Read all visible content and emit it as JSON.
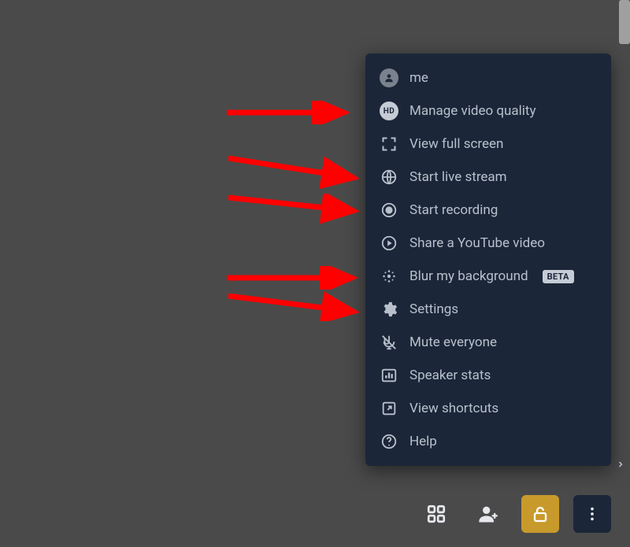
{
  "menu": {
    "items": [
      {
        "icon": "avatar-icon",
        "label": "me"
      },
      {
        "icon": "hd-icon",
        "hd_text": "HD",
        "label": "Manage video quality"
      },
      {
        "icon": "fullscreen-icon",
        "label": "View full screen"
      },
      {
        "icon": "globe-icon",
        "label": "Start live stream"
      },
      {
        "icon": "record-icon",
        "label": "Start recording"
      },
      {
        "icon": "play-circle-icon",
        "label": "Share a YouTube video"
      },
      {
        "icon": "blur-icon",
        "label": "Blur my background",
        "badge": "BETA"
      },
      {
        "icon": "gear-icon",
        "label": "Settings"
      },
      {
        "icon": "mute-all-icon",
        "label": "Mute everyone"
      },
      {
        "icon": "stats-icon",
        "label": "Speaker stats"
      },
      {
        "icon": "shortcuts-icon",
        "label": "View shortcuts"
      },
      {
        "icon": "help-icon",
        "label": "Help"
      }
    ]
  },
  "toolbar": {
    "tiles_label": "tile-view",
    "invite_label": "invite",
    "security_label": "security",
    "more_label": "more-actions"
  },
  "annotations": {
    "arrow_color": "#ff0000"
  }
}
